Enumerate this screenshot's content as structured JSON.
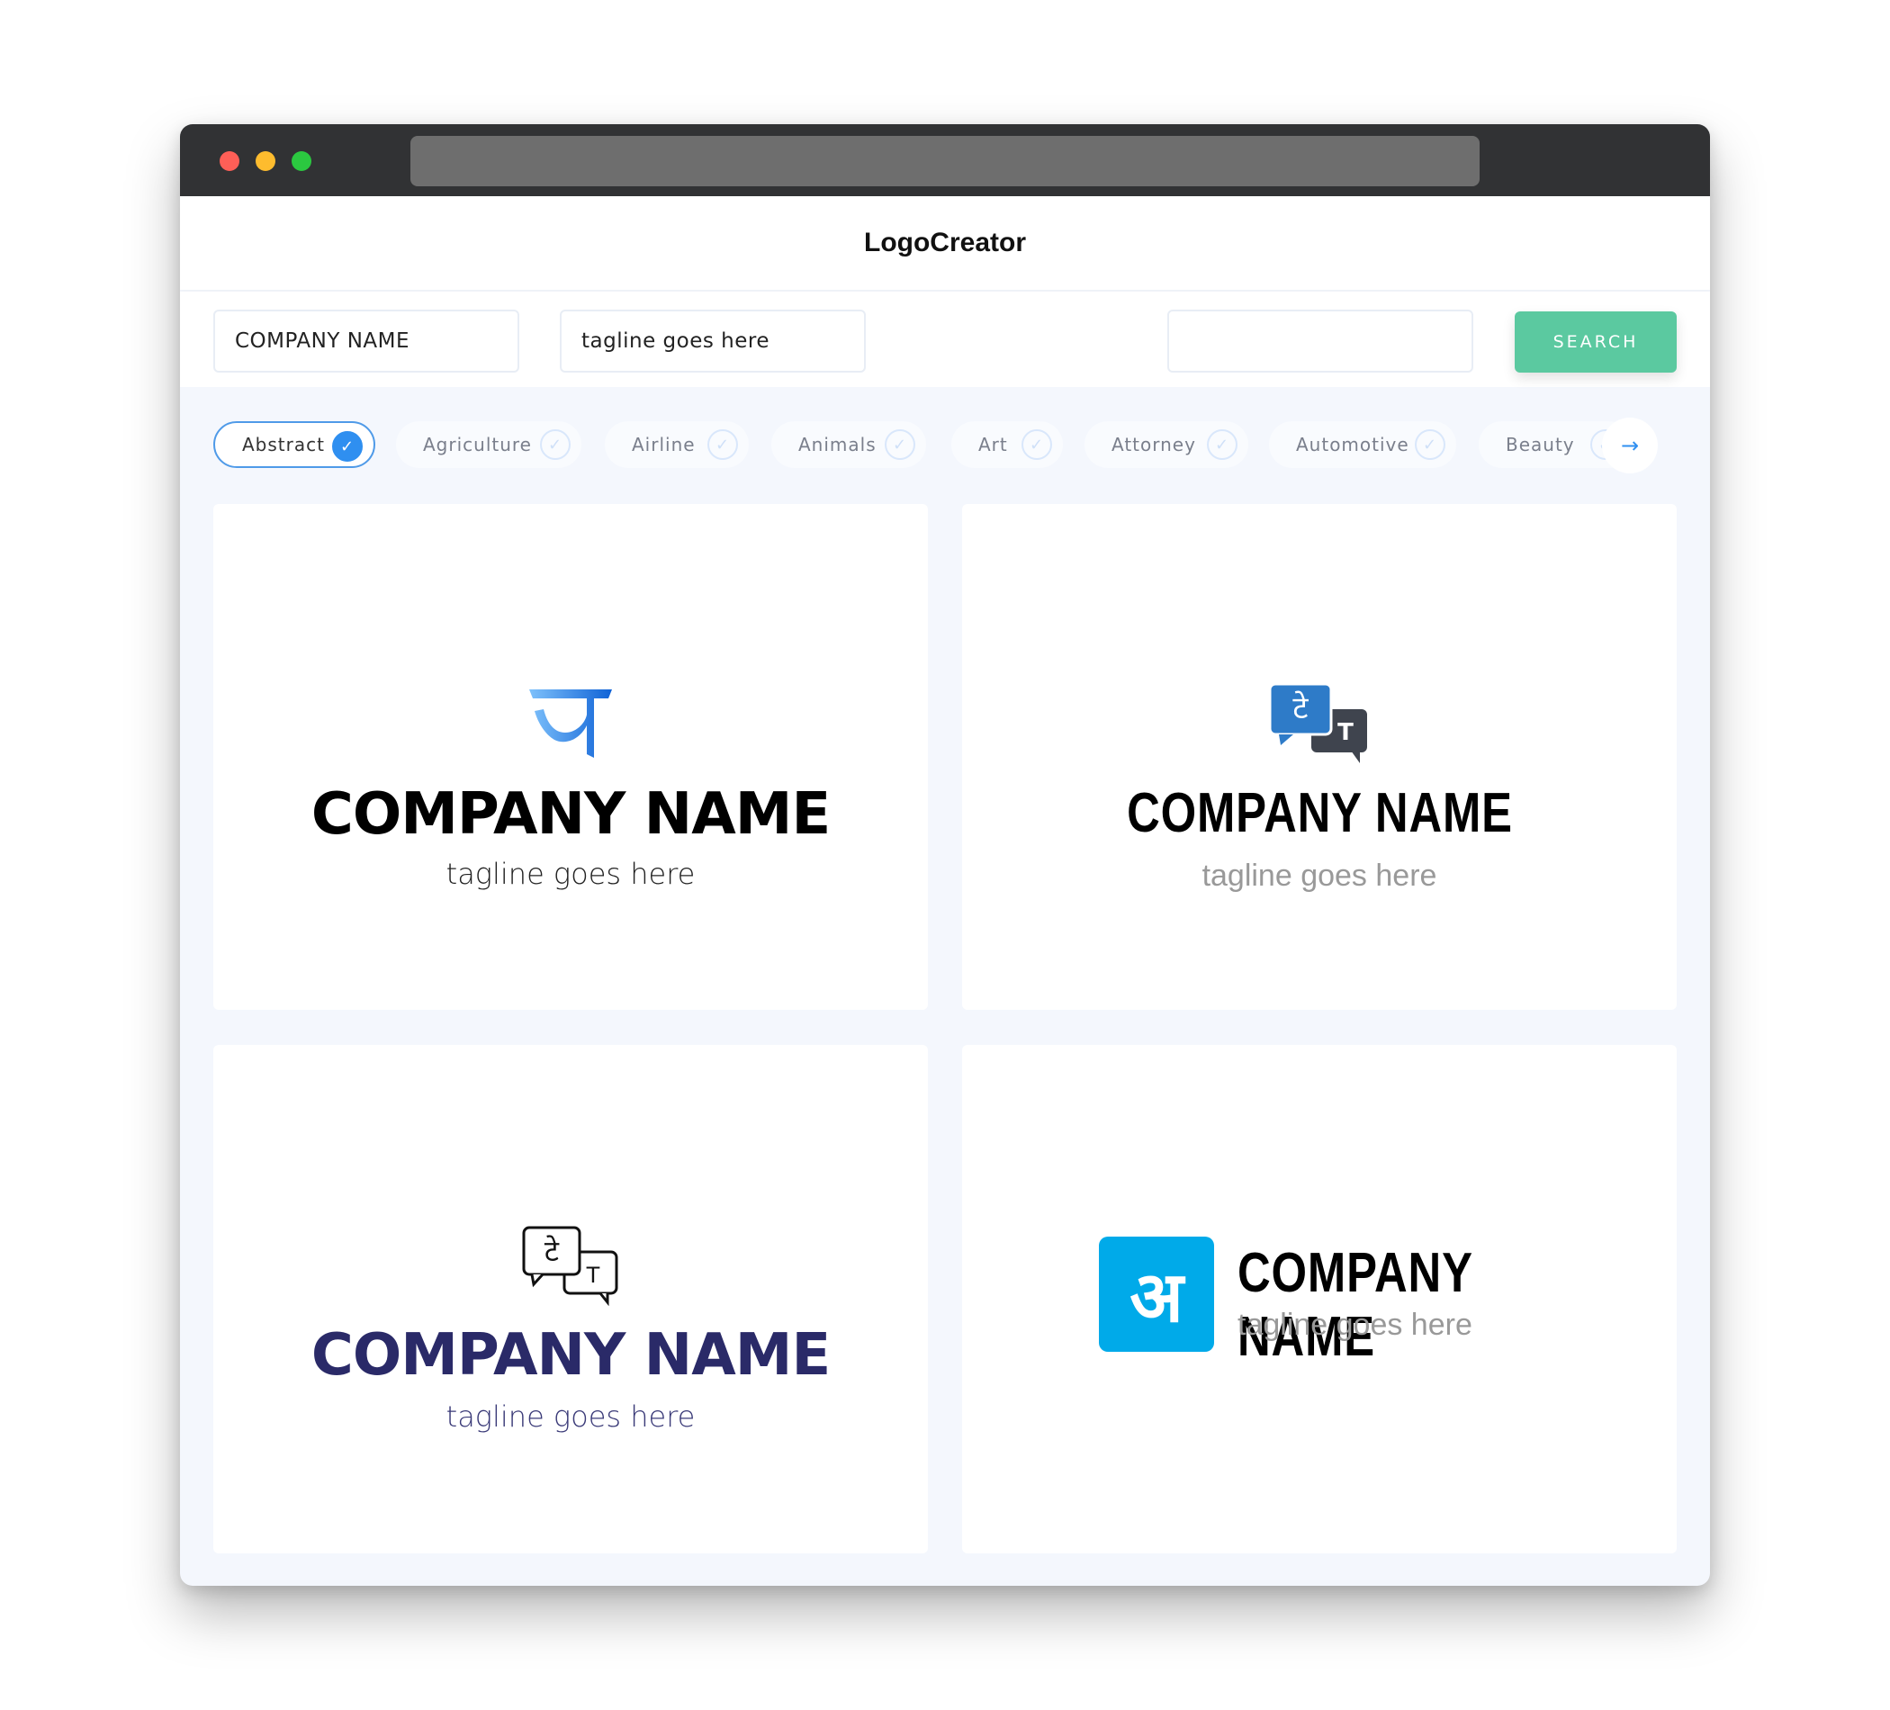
{
  "window": {
    "controls": [
      "close",
      "minimize",
      "maximize"
    ]
  },
  "header": {
    "title": "LogoCreator"
  },
  "search": {
    "company_value": "COMPANY NAME",
    "tagline_value": "tagline goes here",
    "keyword_value": "",
    "button_label": "SEARCH"
  },
  "categories": [
    {
      "label": "Abstract",
      "selected": true
    },
    {
      "label": "Agriculture",
      "selected": false
    },
    {
      "label": "Airline",
      "selected": false
    },
    {
      "label": "Animals",
      "selected": false
    },
    {
      "label": "Art",
      "selected": false
    },
    {
      "label": "Attorney",
      "selected": false
    },
    {
      "label": "Automotive",
      "selected": false
    },
    {
      "label": "Beauty",
      "selected": false
    }
  ],
  "check_glyph": "✓",
  "next_glyph": "→",
  "logos": [
    {
      "icon": "devanagari-ja-icon",
      "glyph": "ज",
      "name": "COMPANY NAME",
      "tagline": "tagline goes here",
      "color": "#2f80ed"
    },
    {
      "icon": "translate-bubbles-filled-icon",
      "glyph": "टे",
      "glyph2": "T",
      "name": "COMPANY NAME",
      "tagline": "tagline goes here",
      "color": "#2e7bc8"
    },
    {
      "icon": "translate-bubbles-outline-icon",
      "glyph": "टे",
      "glyph2": "T",
      "name": "COMPANY NAME",
      "tagline": "tagline goes here",
      "color": "#2a2a68"
    },
    {
      "icon": "devanagari-a-square-icon",
      "glyph": "अ",
      "name": "COMPANY NAME",
      "tagline": "tagline goes here",
      "color": "#00aae9"
    }
  ],
  "colors": {
    "accent": "#2f8ff0",
    "search_button": "#5bc9a0",
    "background": "#f4f7fd"
  }
}
